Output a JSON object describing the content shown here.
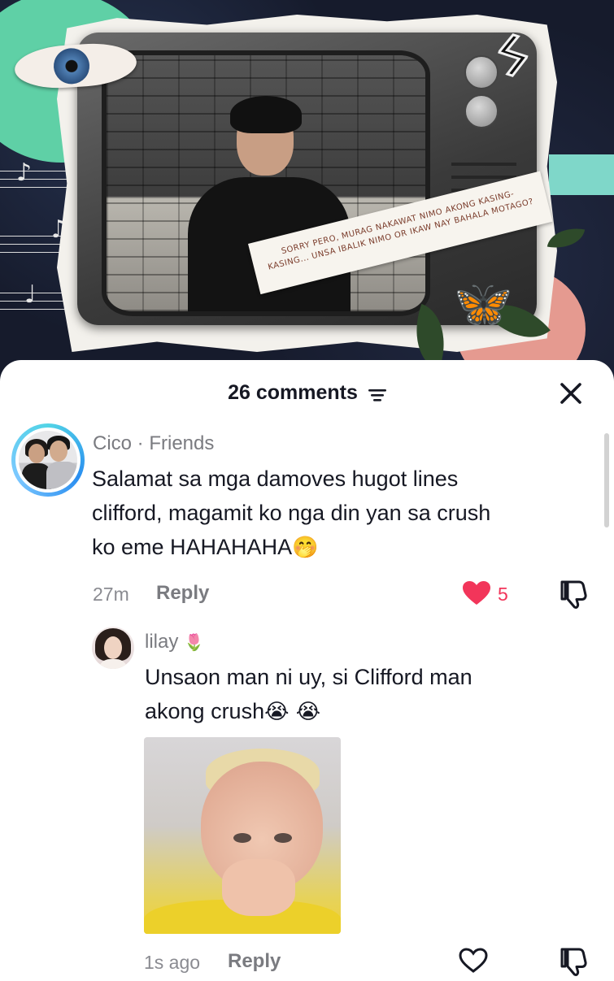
{
  "post": {
    "caption_line1": "SORRY PERO, MURAG NAKAWAT NIMO AKONG KASING-",
    "caption_line2": "KASING... UNSA IBALIK NIMO OR IKAW NAY BAHALA MOTAGO?"
  },
  "sheet": {
    "comments_count": "26 comments"
  },
  "comments": [
    {
      "username": "Cico",
      "relation": " · Friends",
      "text_line1": "Salamat sa mga damoves hugot lines",
      "text_line2": "clifford, magamit ko nga din yan sa crush",
      "text_line3": "ko eme HAHAHAHA",
      "emoji": "🤭",
      "time": "27m",
      "reply_label": "Reply",
      "like_count": "5",
      "liked": true
    },
    {
      "username": "lilay",
      "username_emoji": "🌷",
      "text_line1": "Unsaon man ni uy, si Clifford man",
      "text_line2": "akong crush",
      "emoji": "😭 😭",
      "time": "1s ago",
      "reply_label": "Reply",
      "liked": false
    }
  ],
  "colors": {
    "like_red": "#f2355a",
    "text_primary": "#161823",
    "text_secondary": "#7a7b80"
  }
}
